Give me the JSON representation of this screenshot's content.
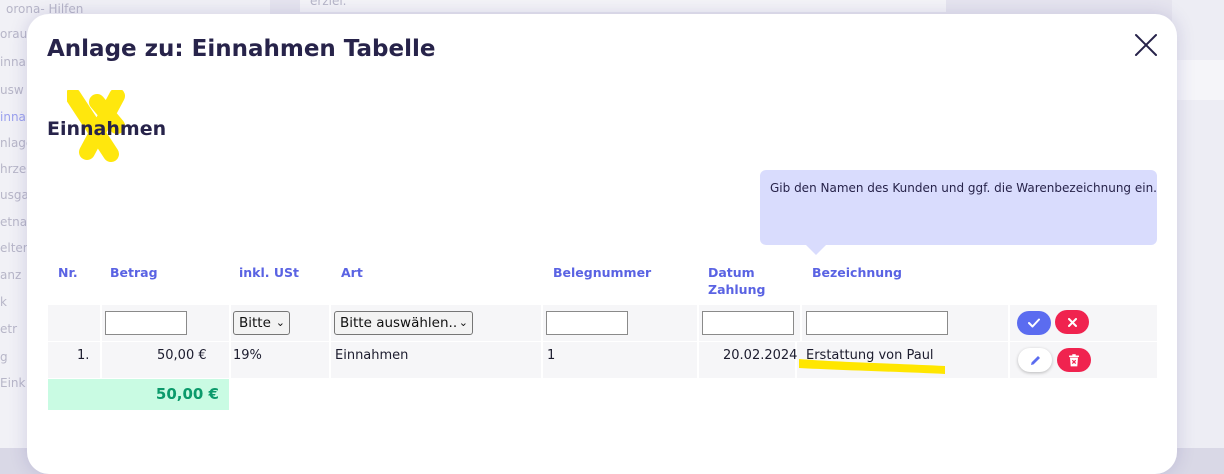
{
  "background": {
    "sidebar_items": [
      "orona- Hilfen",
      "oraus",
      "innah",
      "usw",
      "innah",
      "nlage",
      "hrze",
      "usga",
      "etna",
      "elten",
      "anz",
      "k",
      "etr",
      "g",
      "Eink"
    ],
    "top_text": "erziel."
  },
  "modal": {
    "title": "Anlage zu: Einnahmen Tabelle",
    "section_title": "Einnahmen",
    "tooltip": "Gib den Namen des Kunden und ggf. die Warenbezeichnung ein."
  },
  "table": {
    "headers": {
      "nr": "Nr.",
      "betrag": "Betrag",
      "ust": "inkl. USt",
      "art": "Art",
      "belegnummer": "Belegnummer",
      "datum_line1": "Datum",
      "datum_line2": "Zahlung",
      "bezeichnung": "Bezeichnung"
    },
    "input_row": {
      "betrag_value": "",
      "ust_selected": "Bitte",
      "art_selected": "Bitte auswählen...",
      "belegnummer_value": "",
      "datum_value": "",
      "bezeichnung_value": ""
    },
    "rows": [
      {
        "nr": "1.",
        "betrag": "50,00 €",
        "ust": "19%",
        "art": "Einnahmen",
        "belegnummer": "1",
        "datum": "20.02.2024",
        "bezeichnung": "Erstattung von Paul"
      }
    ],
    "total": "50,00 €"
  },
  "colors": {
    "accent": "#5a63e3",
    "confirm": "#5b6cf0",
    "danger": "#f0234f",
    "total_bg": "#c9fbe3",
    "total_text": "#0b9a6b",
    "highlight": "#ffe600"
  },
  "icons": {
    "close": "close-icon",
    "confirm": "check-icon",
    "cancel": "x-icon",
    "edit": "pencil-icon",
    "delete": "trash-icon"
  }
}
